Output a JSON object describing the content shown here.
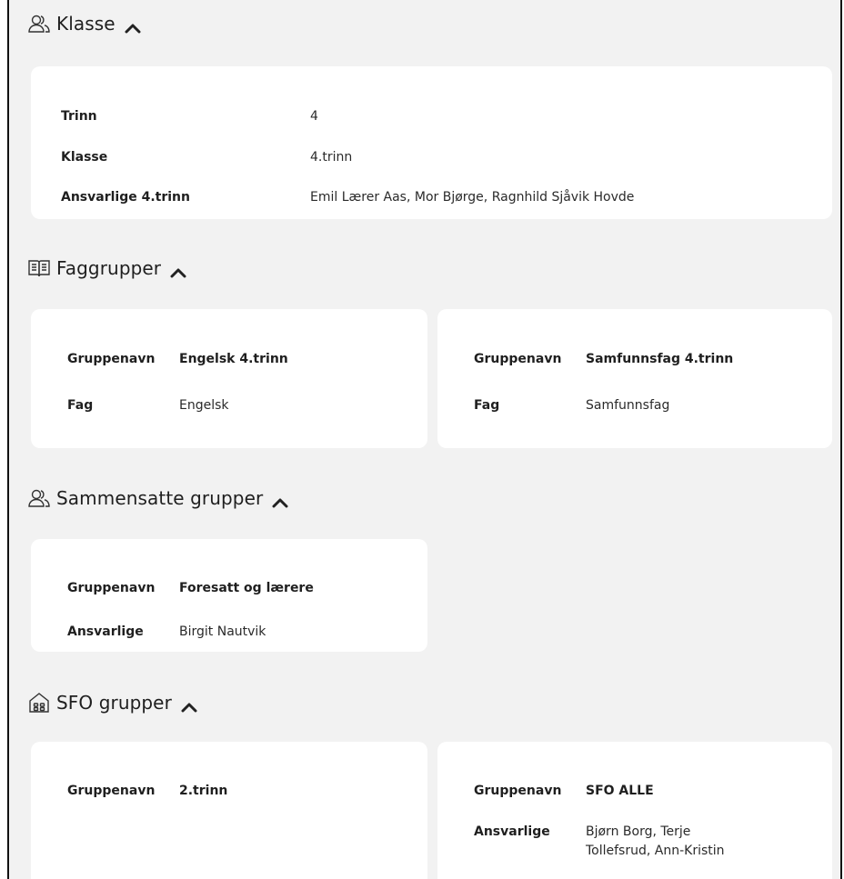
{
  "sections": {
    "klasse": {
      "title": "Klasse",
      "icon": "users-icon",
      "rows": [
        {
          "label": "Trinn",
          "value": "4"
        },
        {
          "label": "Klasse",
          "value": "4.trinn"
        },
        {
          "label": "Ansvarlige 4.trinn",
          "value": "Emil Lærer Aas, Mor Bjørge, Ragnhild Sjåvik Hovde"
        }
      ]
    },
    "faggrupper": {
      "title": "Faggrupper",
      "icon": "book-icon",
      "cards": [
        {
          "groupname_label": "Gruppenavn",
          "groupname": "Engelsk 4.trinn",
          "label2": "Fag",
          "value2": "Engelsk"
        },
        {
          "groupname_label": "Gruppenavn",
          "groupname": "Samfunnsfag 4.trinn",
          "label2": "Fag",
          "value2": "Samfunnsfag"
        }
      ]
    },
    "sammensatte": {
      "title": "Sammensatte grupper",
      "icon": "users-icon",
      "cards": [
        {
          "groupname_label": "Gruppenavn",
          "groupname": "Foresatt og lærere",
          "label2": "Ansvarlige",
          "value2": "Birgit Nautvik"
        }
      ]
    },
    "sfo": {
      "title": "SFO grupper",
      "icon": "house-icon",
      "cards": [
        {
          "groupname_label": "Gruppenavn",
          "groupname": "2.trinn"
        },
        {
          "groupname_label": "Gruppenavn",
          "groupname": "SFO ALLE",
          "label2": "Ansvarlige",
          "value2_line1": "Bjørn Borg, Terje",
          "value2_line2": "Tollefsrud, Ann-Kristin"
        }
      ]
    }
  }
}
